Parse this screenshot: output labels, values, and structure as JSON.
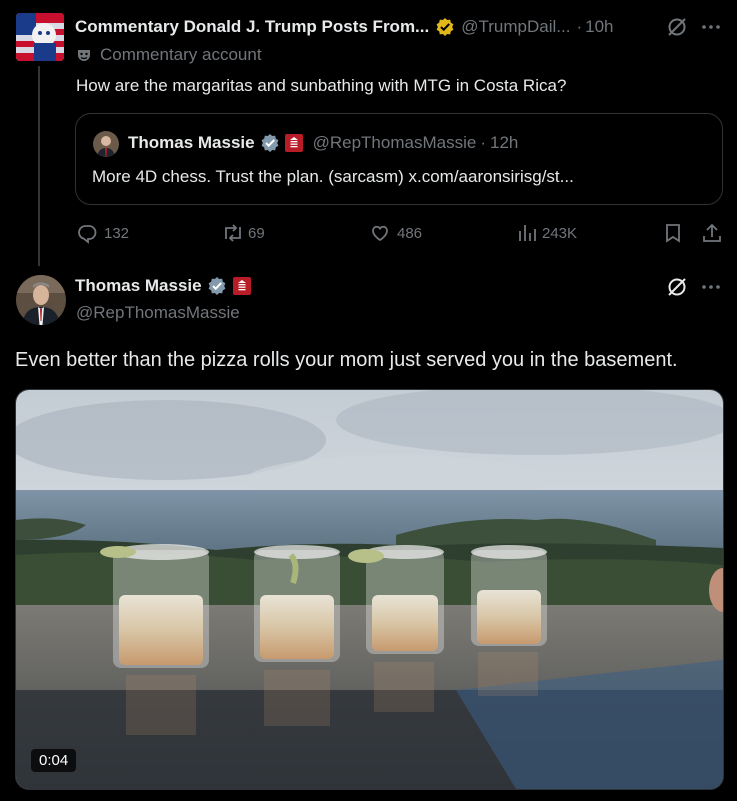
{
  "tweet1": {
    "display_name": "Commentary Donald J. Trump Posts From...",
    "handle": "@TrumpDail...",
    "separator": "·",
    "time": "10h",
    "commentary_label": "Commentary account",
    "text": "How are the margaritas and sunbathing with MTG in Costa Rica?",
    "verified_color": "#e2b719"
  },
  "quote": {
    "display_name": "Thomas Massie",
    "handle": "@RepThomasMassie",
    "separator": "·",
    "time": "12h",
    "text": "More 4D chess. Trust the plan. (sarcasm) x.com/aaronsirisg/st..."
  },
  "actions": {
    "replies": "132",
    "reposts": "69",
    "likes": "486",
    "views": "243K"
  },
  "tweet2": {
    "display_name": "Thomas Massie",
    "handle": "@RepThomasMassie",
    "text": "Even better than the pizza rolls your mom just served you in the basement.",
    "verified_color": "#829aab"
  },
  "media": {
    "type": "video",
    "duration": "0:04"
  },
  "icons": {
    "verified_gold": "verified-gold-badge-icon",
    "verified_gray": "verified-gray-badge-icon",
    "house_seal": "us-house-seal-icon",
    "grok": "grok-icon",
    "more": "more-dots-icon",
    "reply": "reply-icon",
    "repost": "repost-icon",
    "like": "like-icon",
    "views": "views-icon",
    "bookmark": "bookmark-icon",
    "share": "share-icon",
    "commentary": "mask-icon"
  }
}
